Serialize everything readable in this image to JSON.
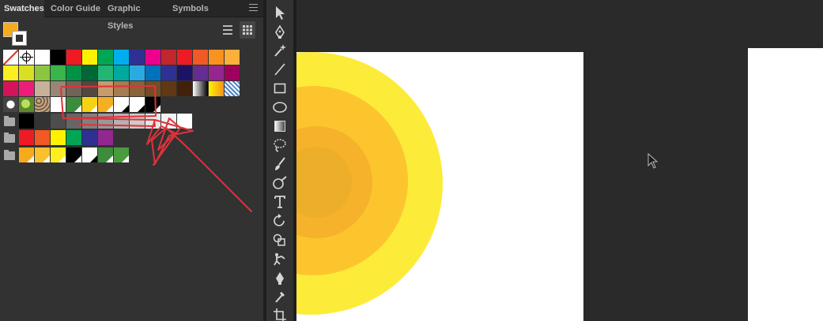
{
  "panel": {
    "tabs": [
      {
        "label": "Swatches",
        "active": true
      },
      {
        "label": "Color Guide",
        "active": false
      },
      {
        "label": "Graphic Styles",
        "active": false
      },
      {
        "label": "Symbols",
        "active": false
      }
    ],
    "menu_icon": "hamburger-menu-icon",
    "fill_color": "#f6ab1c",
    "view_buttons": [
      "list-view-icon",
      "grid-view-icon"
    ],
    "swatch_rows": [
      [
        "none",
        "registration",
        "#ffffff",
        "#000000",
        "#ed1c24",
        "#fff200",
        "#00a651",
        "#00aeef",
        "#2e3192",
        "#ec008c",
        "#c1272d",
        "#ed1c24",
        "#f15a24",
        "#f7931e",
        "#fbb03b"
      ],
      [
        "#fcee21",
        "#d9e021",
        "#8cc63f",
        "#39b54a",
        "#009245",
        "#006837",
        "#22b573",
        "#00a99d",
        "#29abe2",
        "#0071bc",
        "#2e3192",
        "#1b1464",
        "#662d91",
        "#93278f",
        "#9e005d"
      ],
      [
        "#d4145a",
        "#ed1e79",
        "#c7b299",
        "#998675",
        "#736357",
        "#534741",
        "#c69c6d",
        "#a67c52",
        "#8c6239",
        "#754c24",
        "#603813",
        "#42210b",
        "gradient-white-black",
        "gradient-yellow-orange",
        "gradient-blue-pattern"
      ],
      [
        "pattern-dots",
        "pattern-foliage",
        "pattern-stone",
        "#ffffff",
        "#3d8b3d",
        "#f5d313",
        "#f4b022",
        "#ffffff",
        "#ffffff",
        "#000000"
      ]
    ],
    "groups": [
      {
        "icon": "folder-icon",
        "swatches": [
          "#000000",
          "#333333",
          "#4d4d4d",
          "#666666",
          "#808080",
          "#999999",
          "#b3b3b3",
          "#cccccc",
          "#e6e6e6",
          "#f2f2f2",
          "#ffffff"
        ]
      },
      {
        "icon": "folder-icon",
        "swatches": [
          "#ed1c24",
          "#f15a24",
          "#fff200",
          "#00a651",
          "#2e3192",
          "#92278f"
        ]
      },
      {
        "icon": "folder-icon",
        "swatches": [
          "#f6ab1c",
          "#fbc02d",
          "#fcee21",
          "#000000",
          "#ffffff",
          "#3d8b3d",
          "#4a9b3e"
        ]
      }
    ]
  },
  "toolbar": {
    "tools": [
      "selection-tool",
      "pen-tool",
      "magic-wand-tool",
      "line-segment-tool",
      "rectangle-tool",
      "ellipse-tool",
      "gradient-tool",
      "lasso-tool",
      "paintbrush-tool",
      "blob-brush-tool",
      "type-tool",
      "rotate-tool",
      "shape-builder-tool",
      "puppet-warp-tool",
      "curvature-pen-tool",
      "eyedropper-tool",
      "artboard-tool"
    ]
  },
  "canvas": {
    "background": "#2a2a2a",
    "artboard_color": "#ffffff",
    "circle_colors": [
      "#fdeb3a",
      "#fcc52d",
      "#f5b22a",
      "#edae29"
    ]
  },
  "annotation": {
    "color": "#e0323a"
  }
}
